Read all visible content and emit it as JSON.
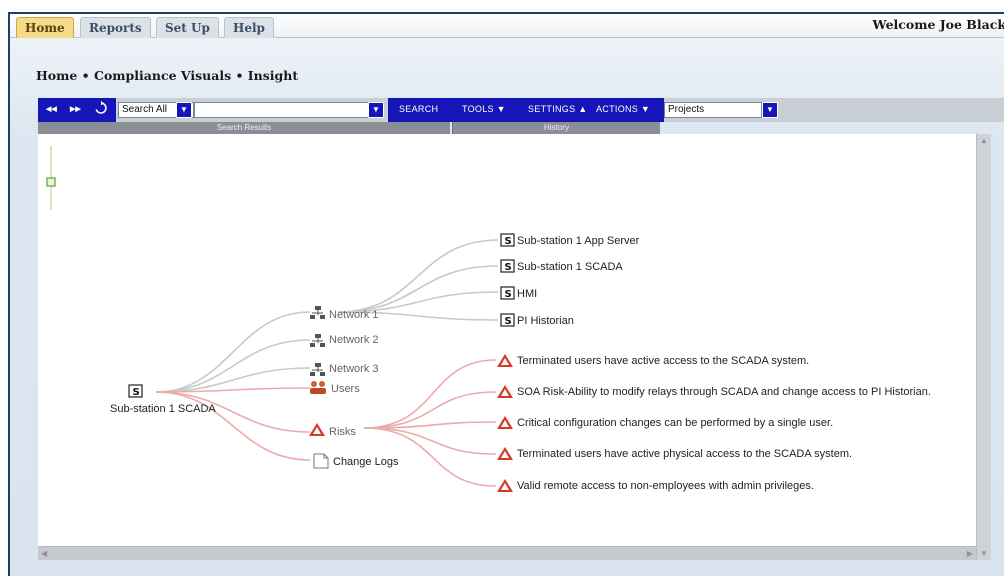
{
  "tabs": [
    {
      "label": "Home",
      "active": true
    },
    {
      "label": "Reports",
      "active": false
    },
    {
      "label": "Set Up",
      "active": false
    },
    {
      "label": "Help",
      "active": false
    }
  ],
  "welcome": "Welcome Joe Black",
  "breadcrumb": "Home • Compliance Visuals • Insight",
  "toolbar": {
    "back_icon": "◀◀",
    "forward_icon": "▶▶",
    "refresh_icon": "refresh-icon",
    "search_scope": "Search All",
    "search_value": "",
    "search_label": "SEARCH",
    "tools_label": "TOOLS",
    "settings_label": "SETTINGS",
    "actions_label": "ACTIONS",
    "project_select": "Projects"
  },
  "subbar": {
    "left": "Search Results",
    "right": "History"
  },
  "graph": {
    "root": "Sub-station 1 SCADA",
    "networks": [
      "Network 1",
      "Network 2",
      "Network 3"
    ],
    "users": "Users",
    "risks": "Risks",
    "change_logs": "Change Logs",
    "servers": [
      "Sub-station 1 App Server",
      "Sub-station 1 SCADA",
      "HMI",
      "PI Historian"
    ],
    "risk_items": [
      "Terminated users have active access to the SCADA system.",
      "SOA Risk-Ability to modify relays through SCADA and change access to PI Historian.",
      "Critical configuration changes can be performed by a single user.",
      "Terminated users have active physical access to the SCADA system.",
      "Valid remote access to non-employees with admin privileges."
    ],
    "colors": {
      "gray_link": "#c8c8c8",
      "red_link": "#ecaaaa",
      "risk_icon": "#d23a2a"
    }
  }
}
